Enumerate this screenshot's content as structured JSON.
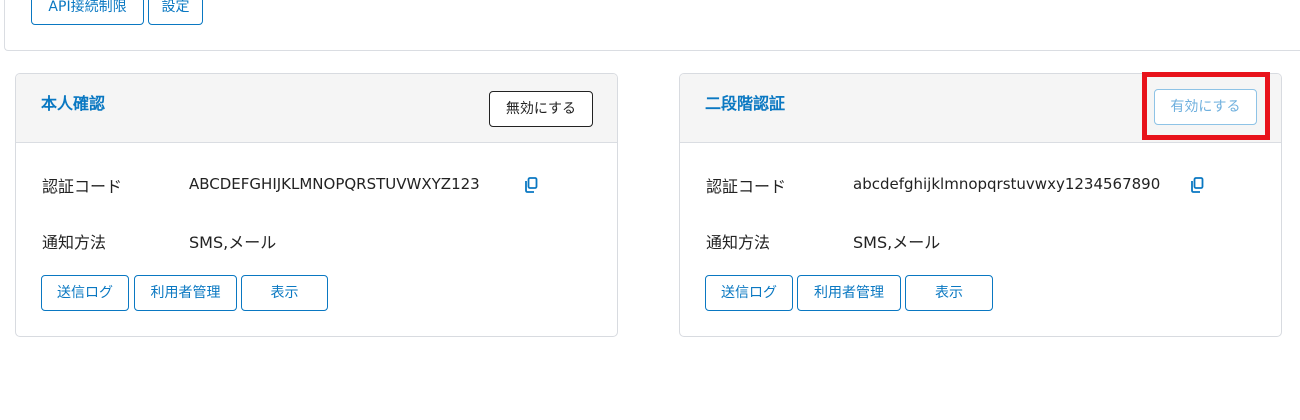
{
  "top_toolbar": {
    "api_limit_label": "API接続制限",
    "settings_label": "設定"
  },
  "cards": [
    {
      "title": "本人確認",
      "header_button": "無効にする",
      "code_label": "認証コード",
      "code_value": "ABCDEFGHIJKLMNOPQRSTUVWXYZ123",
      "method_label": "通知方法",
      "method_value": "SMS,メール",
      "actions": [
        "送信ログ",
        "利用者管理",
        "表示"
      ]
    },
    {
      "title": "二段階認証",
      "header_button": "有効にする",
      "code_label": "認証コード",
      "code_value": "abcdefghijklmnopqrstuvwxy1234567890",
      "method_label": "通知方法",
      "method_value": "SMS,メール",
      "actions": [
        "送信ログ",
        "利用者管理",
        "表示"
      ]
    }
  ],
  "colors": {
    "accent": "#0a78c2",
    "highlight": "#e8131b",
    "disabled_text": "#6fb0de",
    "header_bg": "#f5f5f5"
  },
  "icons": {
    "copy": "copy-icon"
  }
}
